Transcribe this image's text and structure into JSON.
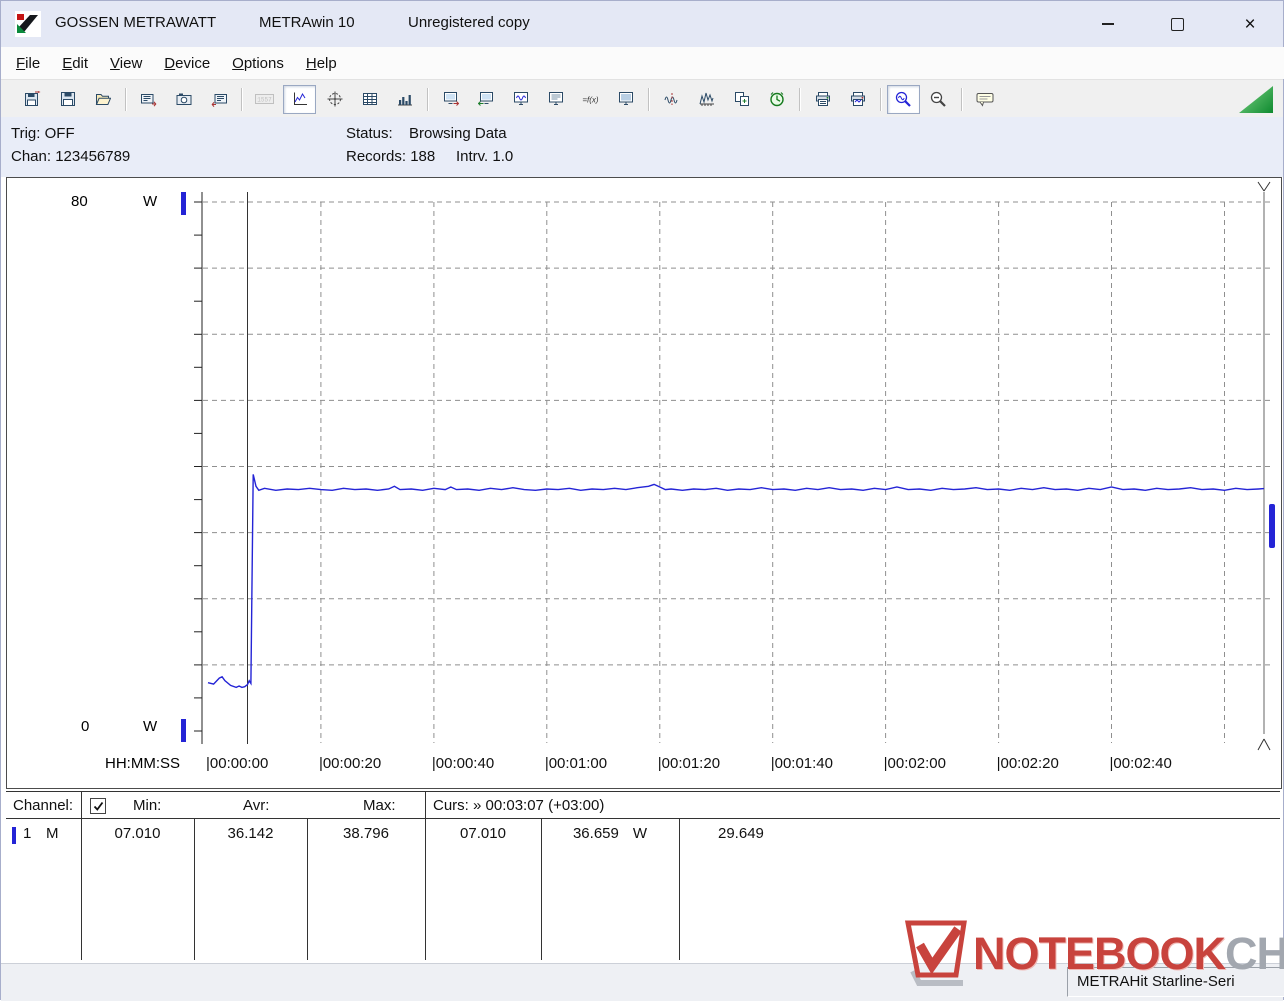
{
  "window": {
    "vendor": "GOSSEN METRAWATT",
    "app": "METRAwin 10",
    "license": "Unregistered copy"
  },
  "menubar": {
    "items": [
      {
        "key": "F",
        "rest": "ile"
      },
      {
        "key": "E",
        "rest": "dit"
      },
      {
        "key": "V",
        "rest": "iew"
      },
      {
        "key": "D",
        "rest": "evice"
      },
      {
        "key": "O",
        "rest": "ptions"
      },
      {
        "key": "H",
        "rest": "elp"
      }
    ]
  },
  "toolbar": {
    "buttons": [
      {
        "name": "save-button",
        "icon": "disk-arrow"
      },
      {
        "name": "save-as-button",
        "icon": "disk"
      },
      {
        "name": "open-button",
        "icon": "folder"
      },
      {
        "sep": true
      },
      {
        "name": "export-button",
        "icon": "card-out"
      },
      {
        "name": "snapshot-button",
        "icon": "camera"
      },
      {
        "name": "import-button",
        "icon": "card-in"
      },
      {
        "sep": true
      },
      {
        "name": "meter-display-button",
        "icon": "lcd",
        "state": "disabled"
      },
      {
        "name": "chart-view-button",
        "icon": "line-chart",
        "state": "active"
      },
      {
        "name": "analog-view-button",
        "icon": "crosshair"
      },
      {
        "name": "table-view-button",
        "icon": "table"
      },
      {
        "name": "histogram-view-button",
        "icon": "histogram"
      },
      {
        "sep": true
      },
      {
        "name": "device-send-button",
        "icon": "monitor-out"
      },
      {
        "name": "device-receive-button",
        "icon": "monitor-in"
      },
      {
        "name": "device-live-button",
        "icon": "monitor-wave"
      },
      {
        "name": "device-screen-button",
        "icon": "monitor"
      },
      {
        "name": "formula-button",
        "icon": "formula"
      },
      {
        "name": "device-memory-button",
        "icon": "monitor-plain"
      },
      {
        "sep": true
      },
      {
        "name": "curve-compress-button",
        "icon": "wave-split"
      },
      {
        "name": "curve-scale-button",
        "icon": "wave-ruler"
      },
      {
        "name": "copy-values-button",
        "icon": "copy-fn"
      },
      {
        "name": "timer-button",
        "icon": "clock"
      },
      {
        "sep": true
      },
      {
        "name": "print-button",
        "icon": "printer"
      },
      {
        "name": "print-graph-button",
        "icon": "printer2"
      },
      {
        "sep": true
      },
      {
        "name": "zoom-time-button",
        "icon": "zoom-wave",
        "state": "active"
      },
      {
        "name": "zoom-reset-button",
        "icon": "zoom-out"
      },
      {
        "sep": true
      },
      {
        "name": "annotate-button",
        "icon": "note"
      }
    ]
  },
  "info": {
    "trig": "Trig: OFF",
    "chan": "Chan: 123456789",
    "status_label": "Status:",
    "status_value": "Browsing Data",
    "records": "Records: 188",
    "interval": "Intrv. 1.0"
  },
  "chart_data": {
    "type": "line",
    "title": "",
    "ylabel_top": "80",
    "ylabel_bottom": "0",
    "yunit": "W",
    "ylim": [
      0,
      80
    ],
    "xlabel": "HH:MM:SS",
    "xlim_seconds": [
      0,
      187
    ],
    "x_tick_seconds": [
      0,
      20,
      40,
      60,
      80,
      100,
      120,
      140,
      160
    ],
    "x_tick_labels": [
      "00:00:00",
      "00:00:20",
      "00:00:40",
      "00:01:00",
      "00:01:20",
      "00:01:40",
      "00:02:00",
      "00:02:20",
      "00:02:40"
    ],
    "grid": "dashed",
    "cursors": {
      "cursor1_seconds": 7,
      "cursor2_seconds": 187
    },
    "series": [
      {
        "name": "Channel 1",
        "unit": "W",
        "color": "#2424d6",
        "points": [
          [
            0,
            7.3
          ],
          [
            1,
            7.1
          ],
          [
            2,
            8.0
          ],
          [
            2.5,
            8.2
          ],
          [
            3,
            7.6
          ],
          [
            4,
            6.9
          ],
          [
            5,
            6.6
          ],
          [
            5.5,
            6.8
          ],
          [
            6,
            6.6
          ],
          [
            6.5,
            6.7
          ],
          [
            7,
            7.01
          ],
          [
            7.3,
            7.6
          ],
          [
            7.6,
            7.2
          ],
          [
            8,
            38.8
          ],
          [
            8.5,
            37.0
          ],
          [
            9,
            36.4
          ],
          [
            10,
            36.7
          ],
          [
            12,
            36.4
          ],
          [
            14,
            36.6
          ],
          [
            16,
            36.5
          ],
          [
            18,
            36.7
          ],
          [
            20,
            36.5
          ],
          [
            22,
            36.4
          ],
          [
            24,
            36.7
          ],
          [
            26,
            36.5
          ],
          [
            28,
            36.6
          ],
          [
            30,
            36.4
          ],
          [
            32,
            36.6
          ],
          [
            33,
            37.0
          ],
          [
            34,
            36.5
          ],
          [
            36,
            36.6
          ],
          [
            38,
            36.4
          ],
          [
            40,
            36.7
          ],
          [
            42,
            36.5
          ],
          [
            43,
            36.9
          ],
          [
            44,
            36.5
          ],
          [
            46,
            36.6
          ],
          [
            48,
            36.4
          ],
          [
            50,
            36.7
          ],
          [
            52,
            36.5
          ],
          [
            54,
            36.8
          ],
          [
            56,
            36.5
          ],
          [
            58,
            36.4
          ],
          [
            60,
            36.6
          ],
          [
            62,
            36.5
          ],
          [
            64,
            36.7
          ],
          [
            66,
            36.4
          ],
          [
            68,
            36.6
          ],
          [
            70,
            36.5
          ],
          [
            72,
            36.7
          ],
          [
            74,
            36.5
          ],
          [
            76,
            36.8
          ],
          [
            78,
            37.0
          ],
          [
            79,
            37.3
          ],
          [
            80,
            36.9
          ],
          [
            81,
            36.5
          ],
          [
            82,
            36.6
          ],
          [
            84,
            36.4
          ],
          [
            86,
            36.6
          ],
          [
            88,
            36.5
          ],
          [
            90,
            36.7
          ],
          [
            92,
            36.4
          ],
          [
            94,
            36.6
          ],
          [
            96,
            36.5
          ],
          [
            98,
            36.8
          ],
          [
            100,
            36.5
          ],
          [
            102,
            36.6
          ],
          [
            104,
            36.4
          ],
          [
            106,
            36.7
          ],
          [
            108,
            36.5
          ],
          [
            110,
            36.8
          ],
          [
            112,
            36.5
          ],
          [
            114,
            36.6
          ],
          [
            116,
            36.4
          ],
          [
            118,
            36.7
          ],
          [
            120,
            36.5
          ],
          [
            122,
            36.9
          ],
          [
            124,
            36.5
          ],
          [
            126,
            36.6
          ],
          [
            128,
            36.4
          ],
          [
            130,
            36.7
          ],
          [
            132,
            36.5
          ],
          [
            134,
            36.6
          ],
          [
            136,
            36.8
          ],
          [
            138,
            36.5
          ],
          [
            140,
            36.6
          ],
          [
            142,
            36.4
          ],
          [
            144,
            36.7
          ],
          [
            146,
            36.5
          ],
          [
            148,
            36.8
          ],
          [
            150,
            36.5
          ],
          [
            152,
            36.6
          ],
          [
            154,
            36.4
          ],
          [
            156,
            36.7
          ],
          [
            158,
            36.5
          ],
          [
            160,
            36.9
          ],
          [
            162,
            36.5
          ],
          [
            164,
            36.6
          ],
          [
            166,
            36.4
          ],
          [
            168,
            36.7
          ],
          [
            170,
            36.5
          ],
          [
            172,
            36.6
          ],
          [
            174,
            36.8
          ],
          [
            176,
            36.5
          ],
          [
            178,
            36.6
          ],
          [
            180,
            36.4
          ],
          [
            182,
            36.7
          ],
          [
            184,
            36.5
          ],
          [
            186,
            36.6
          ],
          [
            187,
            36.659
          ]
        ]
      }
    ]
  },
  "table": {
    "header": {
      "channel": "Channel:",
      "checkbox_checked": true,
      "min": "Min:",
      "avr": "Avr:",
      "max": "Max:",
      "curs": "Curs: » 00:03:07 (+03:00)"
    },
    "row": {
      "channel": "1",
      "mode": "M",
      "min": "07.010",
      "avr": "36.142",
      "max": "38.796",
      "cursor1": "07.010",
      "cursor2": "36.659",
      "unit": "W",
      "delta": "29.649"
    }
  },
  "statusbar": {
    "device": "METRAHit Starline-Seri"
  },
  "watermark": {
    "part1": "NOTEBOOK",
    "part2": "CHECK"
  }
}
